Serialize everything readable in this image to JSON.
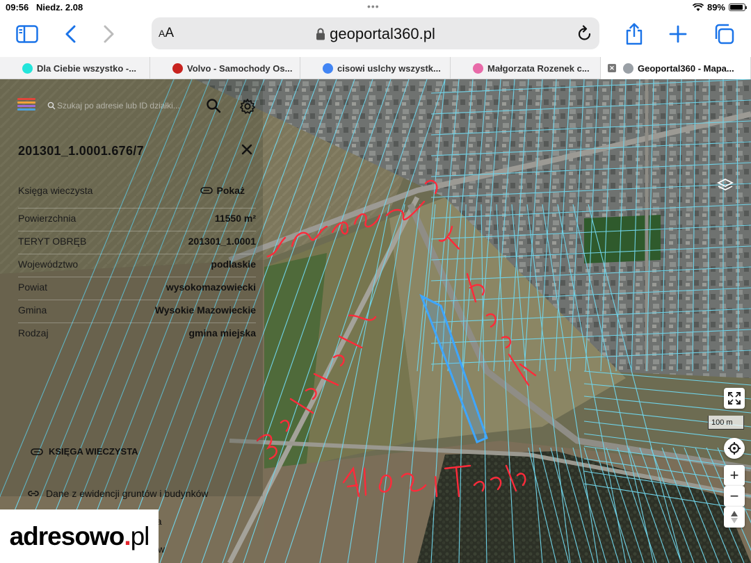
{
  "status": {
    "time": "09:56",
    "date": "Niedz. 2.08",
    "battery": "89%",
    "battery_level": 0.89
  },
  "browser": {
    "url": "geoportal360.pl",
    "text_size_label": "AA",
    "tabs": [
      {
        "label": "Dla Ciebie wszystko -...",
        "favicon": "olx-icon",
        "color": "#23e5db",
        "active": false
      },
      {
        "label": "Volvo - Samochody Os...",
        "favicon": "volvo-icon",
        "color": "#c8231f",
        "active": false
      },
      {
        "label": "cisowi uslchy wszystk...",
        "favicon": "google-icon",
        "color": "#4285f4",
        "active": false
      },
      {
        "label": "Małgorzata Rozenek c...",
        "favicon": "p-icon",
        "color": "#e86aa8",
        "active": false
      },
      {
        "label": "Geoportal360 - Mapa...",
        "favicon": "g-icon",
        "color": "#9aa0a6",
        "active": true
      }
    ]
  },
  "panel": {
    "search_placeholder": "Szukaj po adresie lub ID działki...",
    "parcel_id": "201301_1.0001.676/7",
    "rows": [
      {
        "key": "Księga wieczysta",
        "value": "Pokaż",
        "link": true
      },
      {
        "key": "Powierzchnia",
        "value": "11550 m²"
      },
      {
        "key": "TERYT OBRĘB",
        "value": "201301_1.0001"
      },
      {
        "key": "Województwo",
        "value": "podlaskie"
      },
      {
        "key": "Powiat",
        "value": "wysokomazowiecki"
      },
      {
        "key": "Gmina",
        "value": "Wysokie Mazowieckie"
      },
      {
        "key": "Rodzaj",
        "value": "gmina miejska"
      }
    ],
    "section_label": "KSIĘGA WIECZYSTA",
    "links": [
      "Dane z ewidencji gruntów i budynków",
      "Uzbrojenie terenu w media",
      "Wymiary działki i budynków"
    ]
  },
  "map": {
    "scale": "100 m",
    "annotations": [
      "Ludowa",
      "Al. Niepodl.",
      "Brykalista",
      "Al. Sam Teryt"
    ],
    "parcel_color": "#3ea6ff",
    "annotation_color": "#ff2a3a",
    "boundary_color": "#6fd3e8"
  },
  "watermark": {
    "name": "adresowo",
    "dot": ".",
    "tld": "pl"
  }
}
